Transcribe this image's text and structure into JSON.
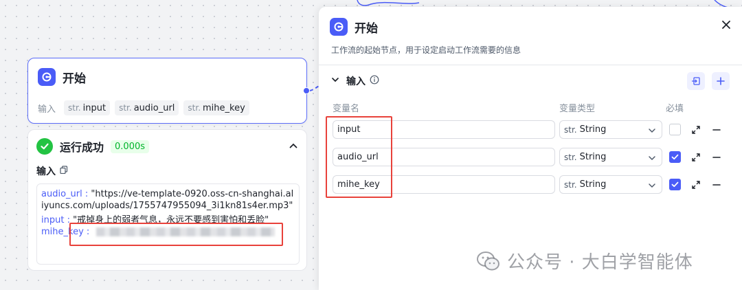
{
  "canvas": {
    "start_node": {
      "title": "开始",
      "vars_label": "输入",
      "vars": [
        {
          "type": "str.",
          "name": "input"
        },
        {
          "type": "str.",
          "name": "audio_url"
        },
        {
          "type": "str.",
          "name": "mihe_key"
        }
      ]
    },
    "run_result": {
      "status": "运行成功",
      "time": "0.000s",
      "input_label": "输入",
      "entries": [
        {
          "key": "audio_url",
          "sep": " : ",
          "value": "\"https://ve-template-0920.oss-cn-shanghai.aliyuncs.com/uploads/1755747955094_3i1kn81s4er.mp3\""
        },
        {
          "key": "input",
          "sep": " : ",
          "value": "\"戒掉身上的弱者气息，永远不要感到害怕和丢脸\""
        },
        {
          "key": "mihe_key",
          "sep": " : ",
          "value": ""
        }
      ]
    }
  },
  "panel": {
    "title": "开始",
    "description": "工作流的起始节点，用于设定启动工作流需要的信息",
    "section_title": "输入",
    "columns": {
      "name": "变量名",
      "type": "变量类型",
      "required": "必填"
    },
    "rows": [
      {
        "name": "input",
        "type_prefix": "str.",
        "type": "String",
        "required": false
      },
      {
        "name": "audio_url",
        "type_prefix": "str.",
        "type": "String",
        "required": true
      },
      {
        "name": "mihe_key",
        "type_prefix": "str.",
        "type": "String",
        "required": true
      }
    ]
  },
  "watermark": {
    "text": "公众号 · 大白学智能体"
  },
  "colors": {
    "accent": "#4a5cf7",
    "success": "#23c343",
    "highlight_red": "#e8413a"
  }
}
